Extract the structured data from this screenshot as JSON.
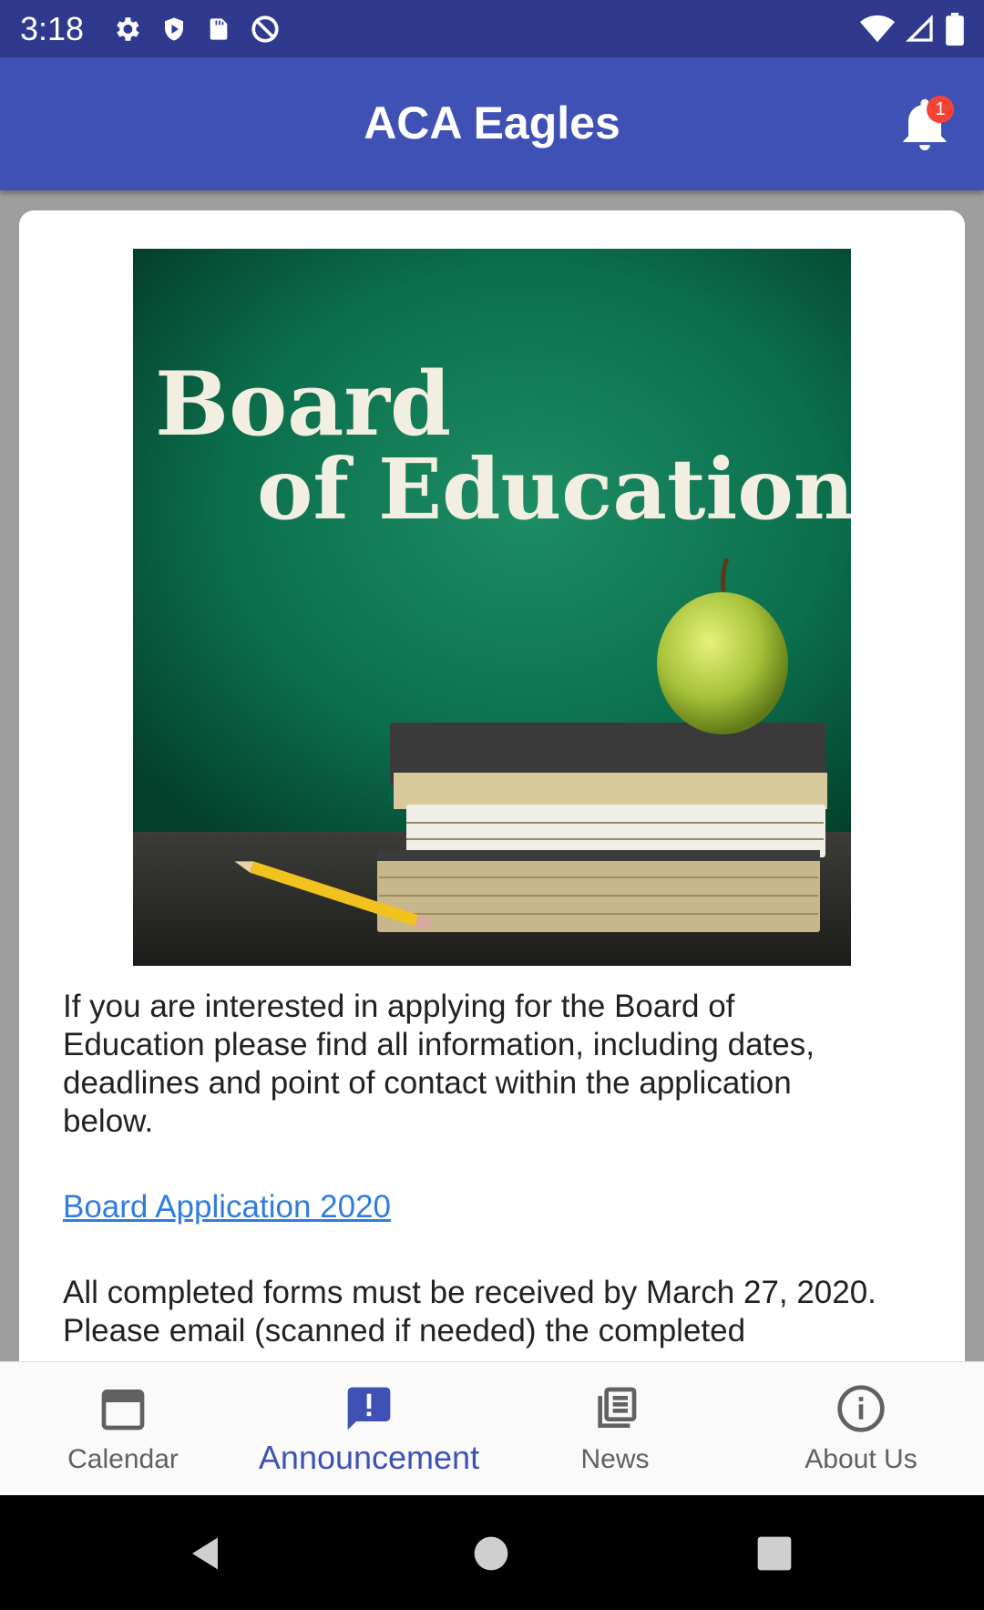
{
  "status_bar": {
    "time": "3:18",
    "left_icons": [
      "settings-icon",
      "shield-play-icon",
      "sd-card-icon",
      "do-not-disturb-icon"
    ],
    "right_icons": [
      "wifi-icon",
      "signal-icon",
      "battery-icon"
    ]
  },
  "app_bar": {
    "title": "ACA Eagles",
    "notification_count": "1"
  },
  "announcement": {
    "image": {
      "title_line1": "Board",
      "title_line2": "of Education"
    },
    "paragraph1": "If you are interested in applying for the Board of Education please find all information, including dates, deadlines and point of contact within the application below.",
    "link_text": "Board Application 2020",
    "paragraph2": "All completed forms must be received by March 27, 2020.  Please email (scanned if needed) the completed"
  },
  "bottom_nav": {
    "items": [
      {
        "label": "Calendar",
        "icon": "calendar-icon",
        "active": false
      },
      {
        "label": "Announcement",
        "icon": "announcement-icon",
        "active": true
      },
      {
        "label": "News",
        "icon": "news-icon",
        "active": false
      },
      {
        "label": "About Us",
        "icon": "info-icon",
        "active": false
      }
    ]
  },
  "colors": {
    "primary": "#3f51b5",
    "status_bar": "#2f3a8f",
    "link": "#2f7de1",
    "badge": "#f44336"
  }
}
